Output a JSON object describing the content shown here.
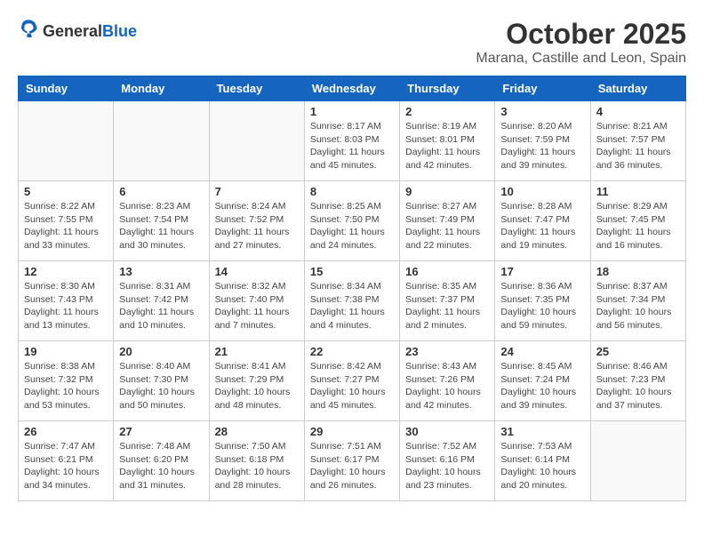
{
  "header": {
    "logo_general": "General",
    "logo_blue": "Blue",
    "month": "October 2025",
    "location": "Marana, Castille and Leon, Spain"
  },
  "weekdays": [
    "Sunday",
    "Monday",
    "Tuesday",
    "Wednesday",
    "Thursday",
    "Friday",
    "Saturday"
  ],
  "weeks": [
    [
      {
        "day": "",
        "info": ""
      },
      {
        "day": "",
        "info": ""
      },
      {
        "day": "",
        "info": ""
      },
      {
        "day": "1",
        "info": "Sunrise: 8:17 AM\nSunset: 8:03 PM\nDaylight: 11 hours\nand 45 minutes."
      },
      {
        "day": "2",
        "info": "Sunrise: 8:19 AM\nSunset: 8:01 PM\nDaylight: 11 hours\nand 42 minutes."
      },
      {
        "day": "3",
        "info": "Sunrise: 8:20 AM\nSunset: 7:59 PM\nDaylight: 11 hours\nand 39 minutes."
      },
      {
        "day": "4",
        "info": "Sunrise: 8:21 AM\nSunset: 7:57 PM\nDaylight: 11 hours\nand 36 minutes."
      }
    ],
    [
      {
        "day": "5",
        "info": "Sunrise: 8:22 AM\nSunset: 7:55 PM\nDaylight: 11 hours\nand 33 minutes."
      },
      {
        "day": "6",
        "info": "Sunrise: 8:23 AM\nSunset: 7:54 PM\nDaylight: 11 hours\nand 30 minutes."
      },
      {
        "day": "7",
        "info": "Sunrise: 8:24 AM\nSunset: 7:52 PM\nDaylight: 11 hours\nand 27 minutes."
      },
      {
        "day": "8",
        "info": "Sunrise: 8:25 AM\nSunset: 7:50 PM\nDaylight: 11 hours\nand 24 minutes."
      },
      {
        "day": "9",
        "info": "Sunrise: 8:27 AM\nSunset: 7:49 PM\nDaylight: 11 hours\nand 22 minutes."
      },
      {
        "day": "10",
        "info": "Sunrise: 8:28 AM\nSunset: 7:47 PM\nDaylight: 11 hours\nand 19 minutes."
      },
      {
        "day": "11",
        "info": "Sunrise: 8:29 AM\nSunset: 7:45 PM\nDaylight: 11 hours\nand 16 minutes."
      }
    ],
    [
      {
        "day": "12",
        "info": "Sunrise: 8:30 AM\nSunset: 7:43 PM\nDaylight: 11 hours\nand 13 minutes."
      },
      {
        "day": "13",
        "info": "Sunrise: 8:31 AM\nSunset: 7:42 PM\nDaylight: 11 hours\nand 10 minutes."
      },
      {
        "day": "14",
        "info": "Sunrise: 8:32 AM\nSunset: 7:40 PM\nDaylight: 11 hours\nand 7 minutes."
      },
      {
        "day": "15",
        "info": "Sunrise: 8:34 AM\nSunset: 7:38 PM\nDaylight: 11 hours\nand 4 minutes."
      },
      {
        "day": "16",
        "info": "Sunrise: 8:35 AM\nSunset: 7:37 PM\nDaylight: 11 hours\nand 2 minutes."
      },
      {
        "day": "17",
        "info": "Sunrise: 8:36 AM\nSunset: 7:35 PM\nDaylight: 10 hours\nand 59 minutes."
      },
      {
        "day": "18",
        "info": "Sunrise: 8:37 AM\nSunset: 7:34 PM\nDaylight: 10 hours\nand 56 minutes."
      }
    ],
    [
      {
        "day": "19",
        "info": "Sunrise: 8:38 AM\nSunset: 7:32 PM\nDaylight: 10 hours\nand 53 minutes."
      },
      {
        "day": "20",
        "info": "Sunrise: 8:40 AM\nSunset: 7:30 PM\nDaylight: 10 hours\nand 50 minutes."
      },
      {
        "day": "21",
        "info": "Sunrise: 8:41 AM\nSunset: 7:29 PM\nDaylight: 10 hours\nand 48 minutes."
      },
      {
        "day": "22",
        "info": "Sunrise: 8:42 AM\nSunset: 7:27 PM\nDaylight: 10 hours\nand 45 minutes."
      },
      {
        "day": "23",
        "info": "Sunrise: 8:43 AM\nSunset: 7:26 PM\nDaylight: 10 hours\nand 42 minutes."
      },
      {
        "day": "24",
        "info": "Sunrise: 8:45 AM\nSunset: 7:24 PM\nDaylight: 10 hours\nand 39 minutes."
      },
      {
        "day": "25",
        "info": "Sunrise: 8:46 AM\nSunset: 7:23 PM\nDaylight: 10 hours\nand 37 minutes."
      }
    ],
    [
      {
        "day": "26",
        "info": "Sunrise: 7:47 AM\nSunset: 6:21 PM\nDaylight: 10 hours\nand 34 minutes."
      },
      {
        "day": "27",
        "info": "Sunrise: 7:48 AM\nSunset: 6:20 PM\nDaylight: 10 hours\nand 31 minutes."
      },
      {
        "day": "28",
        "info": "Sunrise: 7:50 AM\nSunset: 6:18 PM\nDaylight: 10 hours\nand 28 minutes."
      },
      {
        "day": "29",
        "info": "Sunrise: 7:51 AM\nSunset: 6:17 PM\nDaylight: 10 hours\nand 26 minutes."
      },
      {
        "day": "30",
        "info": "Sunrise: 7:52 AM\nSunset: 6:16 PM\nDaylight: 10 hours\nand 23 minutes."
      },
      {
        "day": "31",
        "info": "Sunrise: 7:53 AM\nSunset: 6:14 PM\nDaylight: 10 hours\nand 20 minutes."
      },
      {
        "day": "",
        "info": ""
      }
    ]
  ]
}
